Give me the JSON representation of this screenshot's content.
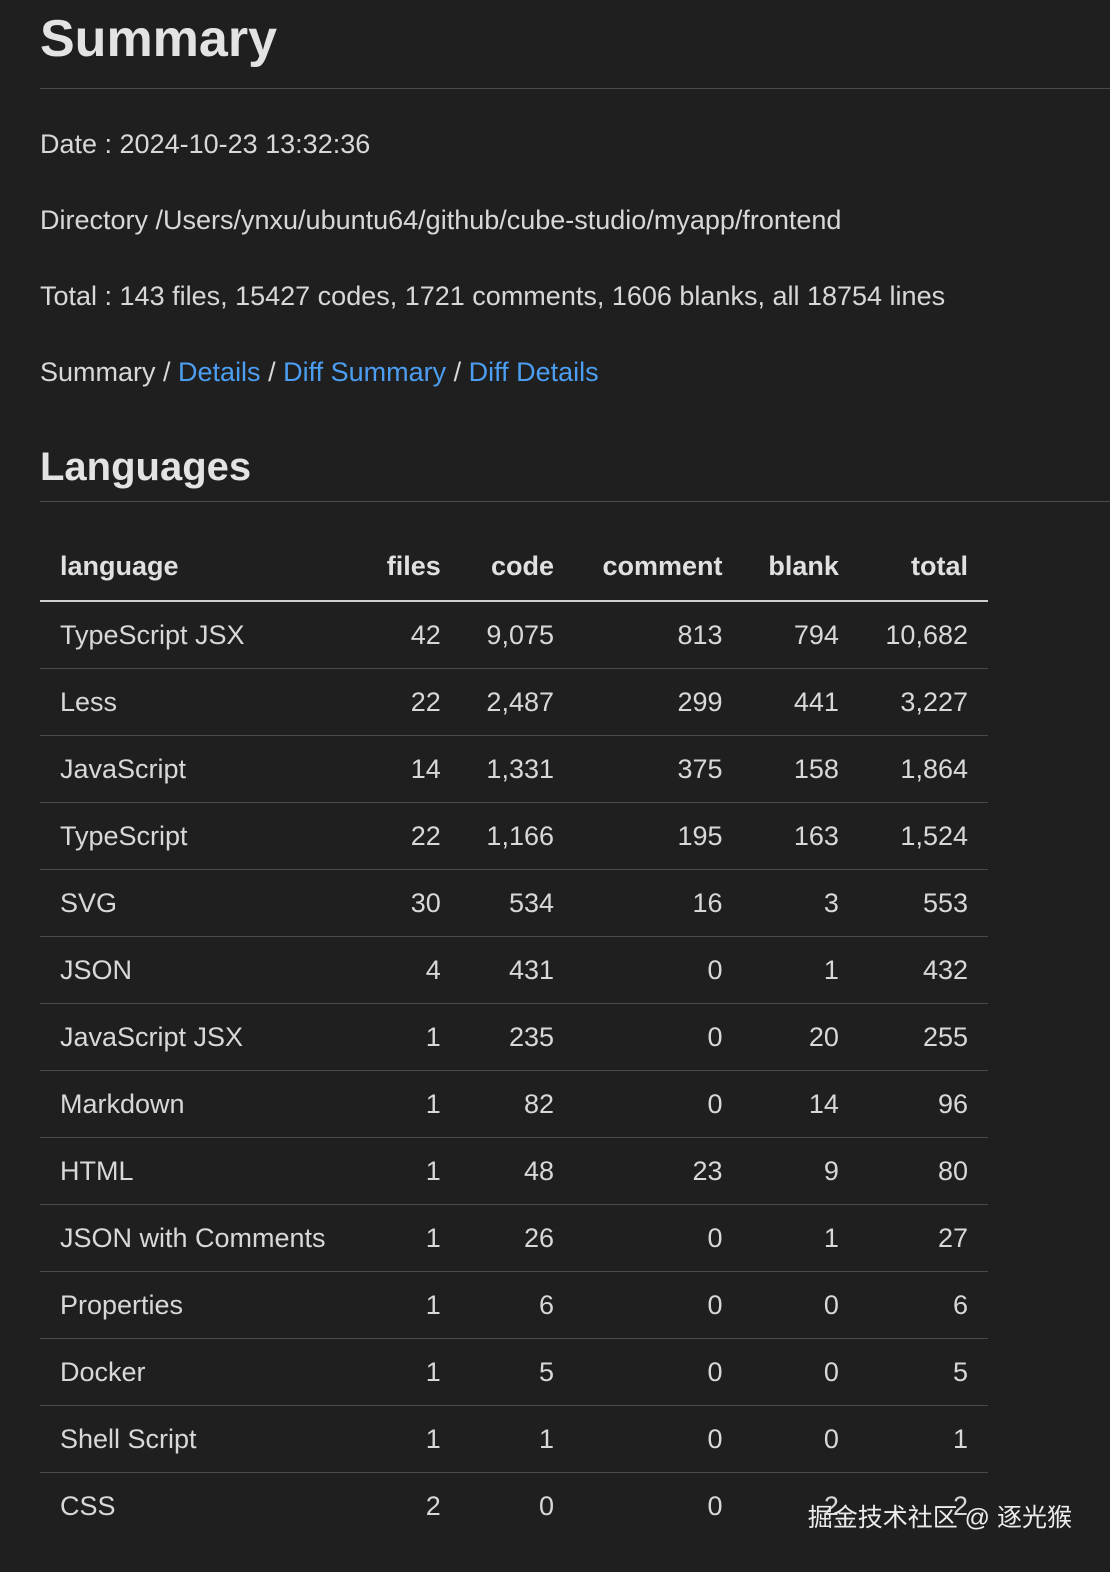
{
  "title": "Summary",
  "date_line": "Date : 2024-10-23 13:32:36",
  "directory_line": "Directory /Users/ynxu/ubuntu64/github/cube-studio/myapp/frontend",
  "total_line": "Total : 143 files, 15427 codes, 1721 comments, 1606 blanks, all 18754 lines",
  "nav": {
    "current": "Summary",
    "separator": " / ",
    "details": "Details",
    "diff_summary": "Diff Summary",
    "diff_details": "Diff Details"
  },
  "languages_heading": "Languages",
  "table": {
    "headers": {
      "language": "language",
      "files": "files",
      "code": "code",
      "comment": "comment",
      "blank": "blank",
      "total": "total"
    },
    "rows": [
      {
        "language": "TypeScript JSX",
        "files": "42",
        "code": "9,075",
        "comment": "813",
        "blank": "794",
        "total": "10,682"
      },
      {
        "language": "Less",
        "files": "22",
        "code": "2,487",
        "comment": "299",
        "blank": "441",
        "total": "3,227"
      },
      {
        "language": "JavaScript",
        "files": "14",
        "code": "1,331",
        "comment": "375",
        "blank": "158",
        "total": "1,864"
      },
      {
        "language": "TypeScript",
        "files": "22",
        "code": "1,166",
        "comment": "195",
        "blank": "163",
        "total": "1,524"
      },
      {
        "language": "SVG",
        "files": "30",
        "code": "534",
        "comment": "16",
        "blank": "3",
        "total": "553"
      },
      {
        "language": "JSON",
        "files": "4",
        "code": "431",
        "comment": "0",
        "blank": "1",
        "total": "432"
      },
      {
        "language": "JavaScript JSX",
        "files": "1",
        "code": "235",
        "comment": "0",
        "blank": "20",
        "total": "255"
      },
      {
        "language": "Markdown",
        "files": "1",
        "code": "82",
        "comment": "0",
        "blank": "14",
        "total": "96"
      },
      {
        "language": "HTML",
        "files": "1",
        "code": "48",
        "comment": "23",
        "blank": "9",
        "total": "80"
      },
      {
        "language": "JSON with Comments",
        "files": "1",
        "code": "26",
        "comment": "0",
        "blank": "1",
        "total": "27"
      },
      {
        "language": "Properties",
        "files": "1",
        "code": "6",
        "comment": "0",
        "blank": "0",
        "total": "6"
      },
      {
        "language": "Docker",
        "files": "1",
        "code": "5",
        "comment": "0",
        "blank": "0",
        "total": "5"
      },
      {
        "language": "Shell Script",
        "files": "1",
        "code": "1",
        "comment": "0",
        "blank": "0",
        "total": "1"
      },
      {
        "language": "CSS",
        "files": "2",
        "code": "0",
        "comment": "0",
        "blank": "2",
        "total": "2"
      }
    ]
  },
  "watermark": "掘金技术社区 @ 逐光猴"
}
